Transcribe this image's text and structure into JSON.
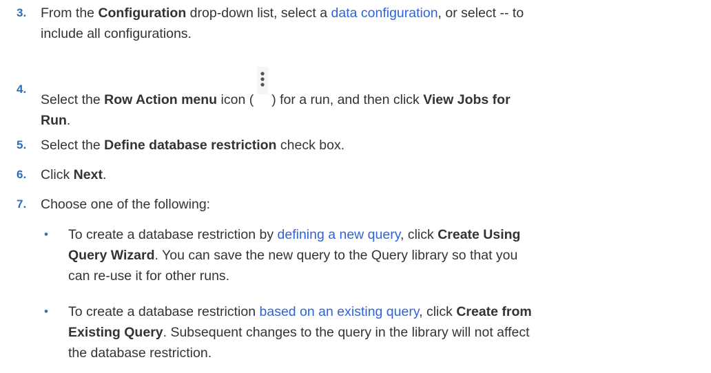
{
  "steps": [
    {
      "number": "3.",
      "parts": {
        "a": "From the ",
        "b": "Configuration",
        "c": " drop-down list, select a ",
        "link": "data configuration",
        "d": ", or select -- to",
        "e": "include all configurations."
      }
    },
    {
      "number": "4.",
      "parts": {
        "a": "Select the ",
        "b": "Row Action menu",
        "c": " icon (",
        "d": ") for a run, and then click ",
        "e": "View Jobs for",
        "f": "Run",
        "g": "."
      },
      "icon": "vertical-ellipsis-icon"
    },
    {
      "number": "5.",
      "parts": {
        "a": "Select the ",
        "b": "Define database restriction",
        "c": " check box."
      }
    },
    {
      "number": "6.",
      "parts": {
        "a": "Click ",
        "b": "Next",
        "c": "."
      }
    },
    {
      "number": "7.",
      "parts": {
        "a": "Choose one of the following:"
      }
    }
  ],
  "bullets": [
    {
      "marker": "•",
      "parts": {
        "a": "To create a database restriction by ",
        "link": "defining a new query",
        "b": ", click ",
        "c": "Create Using",
        "d": "Query Wizard",
        "e": ". You can save the new query to the Query library so that you",
        "f": "can re-use it for other runs."
      }
    },
    {
      "marker": "•",
      "parts": {
        "a": "To create a database restriction ",
        "link": "based on an existing query",
        "b": ", click ",
        "c": "Create from",
        "d": "Existing Query",
        "e": ". Subsequent changes to the query in the library will not affect",
        "f": "the database restriction."
      }
    }
  ],
  "colors": {
    "step_number": "#2e6bb8",
    "link": "#2e63d6",
    "text": "#333333"
  }
}
